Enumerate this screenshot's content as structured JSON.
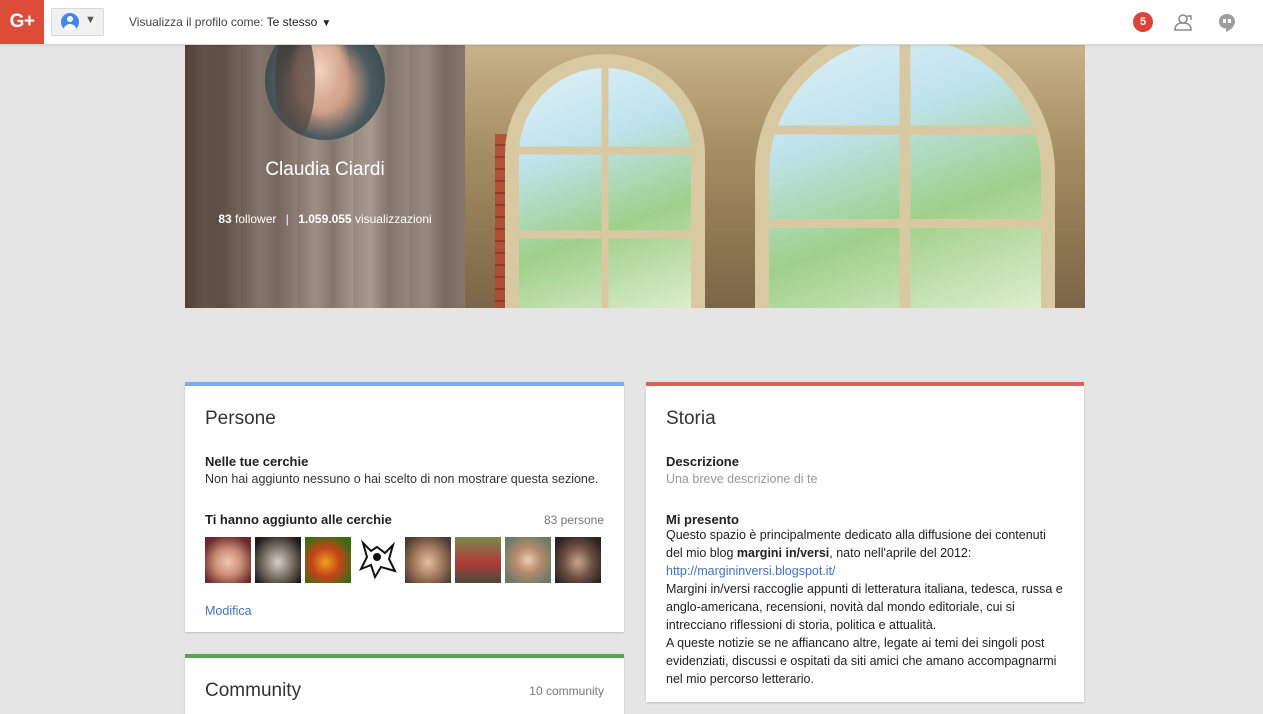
{
  "topbar": {
    "logo": "G+",
    "view_as_label": "Visualizza il profilo come:",
    "view_as_value": "Te stesso",
    "notifications_count": "5"
  },
  "profile": {
    "name": "Claudia Ciardi",
    "followers_count": "83",
    "followers_label": "follower",
    "separator": "|",
    "views_count": "1.059.055",
    "views_label": "visualizzazioni"
  },
  "persone": {
    "title": "Persone",
    "in_circles_title": "Nelle tue cerchie",
    "in_circles_text": "Non hai aggiunto nessuno o hai scelto di non mostrare questa sezione.",
    "added_title": "Ti hanno aggiunto alle cerchie",
    "added_count": "83 persone",
    "edit_link": "Modifica"
  },
  "community": {
    "title": "Community",
    "count": "10 community"
  },
  "storia": {
    "title": "Storia",
    "descr_title": "Descrizione",
    "descr_placeholder": "Una breve descrizione di te",
    "intro_title": "Mi presento",
    "p1_a": "Questo spazio è principalmente dedicato alla diffusione dei contenuti del mio blog ",
    "p1_bold": "margini in/versi",
    "p1_b": ", nato nell'aprile del 2012:",
    "p1_link": "http://margininversi.blogspot.it/",
    "p2": "Margini in/versi raccoglie appunti di letteratura italiana, tedesca, russa e anglo-americana, recensioni, novità dal mondo editoriale, cui si intrecciano riflessioni di storia, politica e attualità.",
    "p3": "A queste notizie se ne affiancano altre, legate ai temi dei singoli post evidenziati, discussi e ospitati da siti amici che amano accompagnarmi nel mio percorso letterario."
  }
}
